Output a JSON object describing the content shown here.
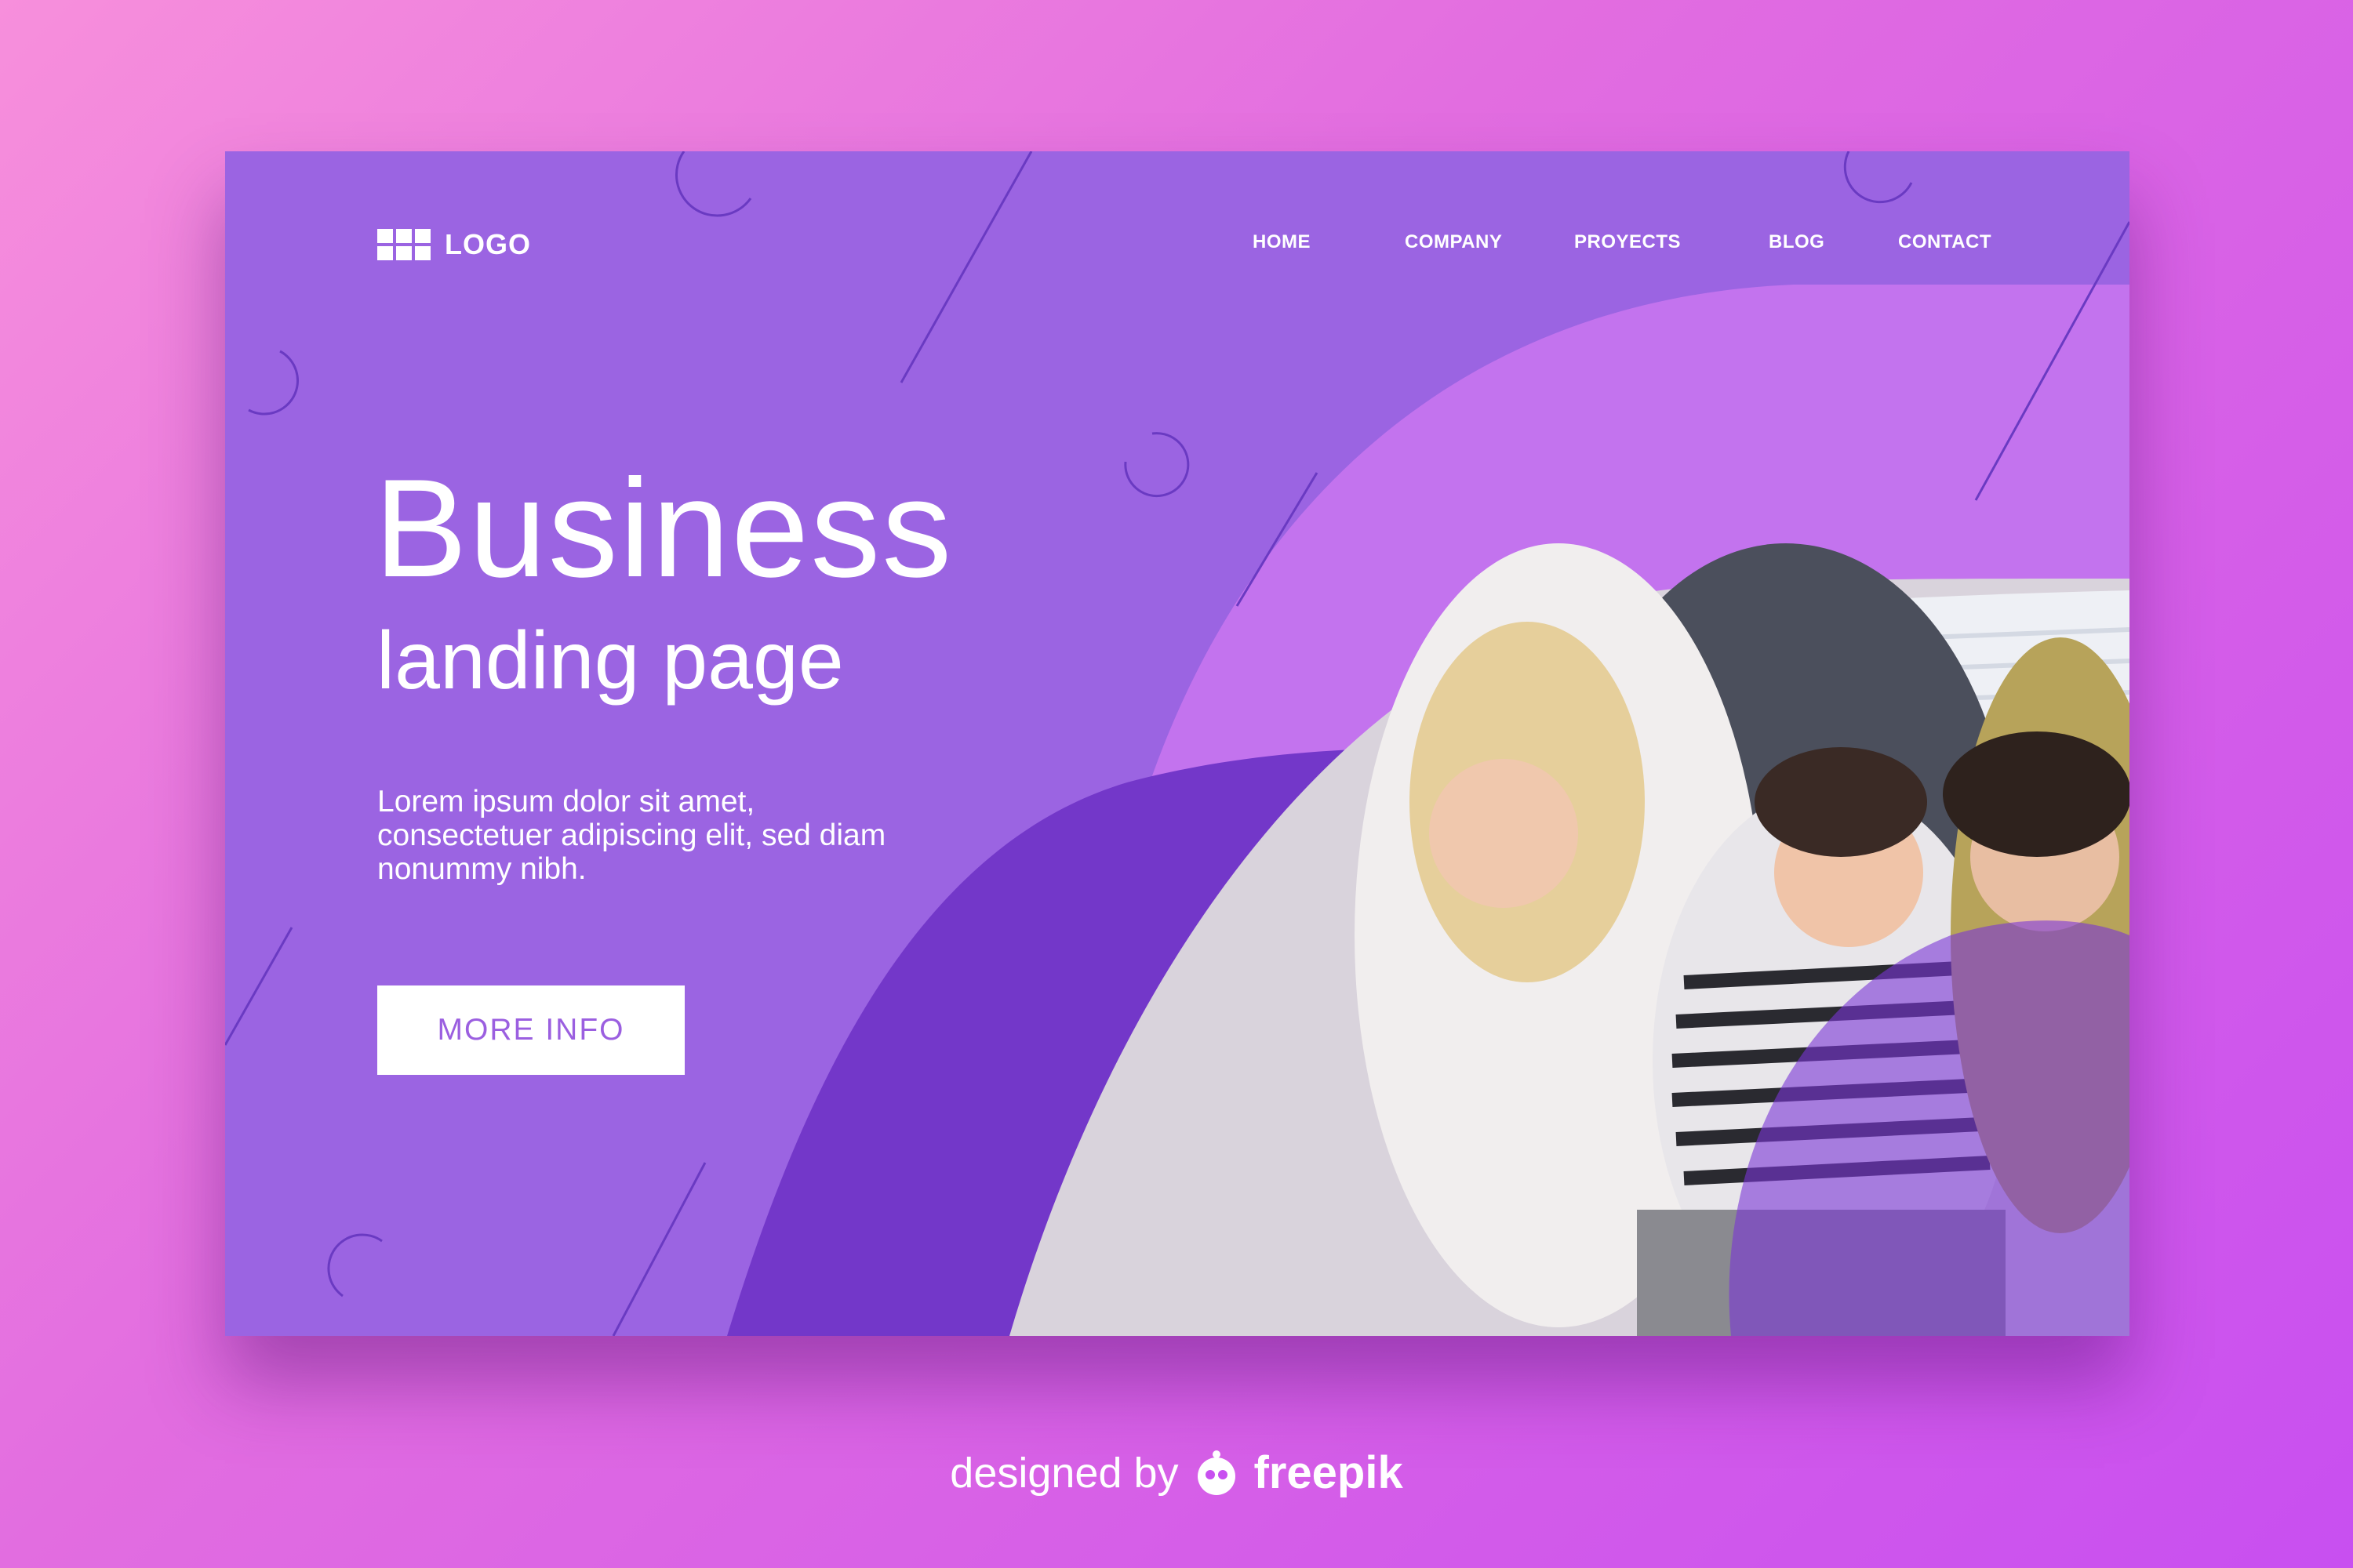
{
  "logo": {
    "text": "LOGO",
    "icon": "grid-icon"
  },
  "nav": [
    "HOME",
    "COMPANY",
    "PROYECTS",
    "BLOG",
    "CONTACT"
  ],
  "hero": {
    "title": "Business",
    "subtitle": "landing page",
    "body": "Lorem ipsum dolor sit amet, consectetuer adipiscing elit, sed diam nonummy nibh.",
    "button_label": "MORE INFO"
  },
  "credit": {
    "prefix": "designed by",
    "brand": "freepik",
    "icon": "freepik-mascot-icon"
  },
  "colors": {
    "card": "#9b64e2",
    "dark_purple": "#7136c9",
    "light_purple": "#c878f0",
    "accent_magenta": "#d070f0",
    "button_text": "#9b5fe0"
  }
}
